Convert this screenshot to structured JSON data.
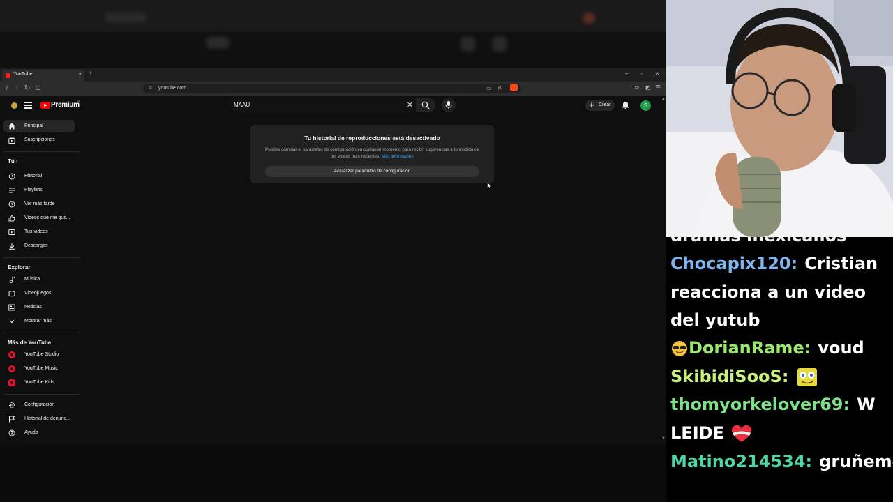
{
  "browser": {
    "tab_title": "YouTube",
    "tab_close": "×",
    "new_tab": "+",
    "url": "youtube.com",
    "win_min": "–",
    "win_max": "▫",
    "win_close": "×"
  },
  "youtube": {
    "logo_text": "Premium",
    "region": "PE",
    "search_query": "MAAU",
    "create_label": "Crear",
    "user_initial": "S",
    "sidebar": {
      "main": [
        {
          "label": "Principal",
          "icon": "home-icon"
        },
        {
          "label": "Suscripciones",
          "icon": "subscriptions-icon"
        }
      ],
      "you_header": "Tú",
      "you_items": [
        {
          "label": "Historial",
          "icon": "history-icon"
        },
        {
          "label": "Playlists",
          "icon": "playlists-icon"
        },
        {
          "label": "Ver más tarde",
          "icon": "watch-later-icon"
        },
        {
          "label": "Videos que me gus...",
          "icon": "like-icon"
        },
        {
          "label": "Tus videos",
          "icon": "your-videos-icon"
        },
        {
          "label": "Descargas",
          "icon": "download-icon"
        }
      ],
      "explore_header": "Explorar",
      "explore_items": [
        {
          "label": "Música",
          "icon": "music-icon"
        },
        {
          "label": "Videojuegos",
          "icon": "gaming-icon"
        },
        {
          "label": "Noticias",
          "icon": "news-icon"
        },
        {
          "label": "Mostrar más",
          "icon": "chevron-down-icon"
        }
      ],
      "more_header": "Más de YouTube",
      "more_items": [
        {
          "label": "YouTube Studio"
        },
        {
          "label": "YouTube Music"
        },
        {
          "label": "YouTube Kids"
        }
      ],
      "settings_items": [
        {
          "label": "Configuración",
          "icon": "gear-icon"
        },
        {
          "label": "Historial de denunc...",
          "icon": "flag-icon"
        },
        {
          "label": "Ayuda",
          "icon": "help-icon"
        }
      ]
    },
    "history_card": {
      "title": "Tu historial de reproducciones está desactivado",
      "body": "Puedes cambiar el parámetro de configuración en cualquier momento para recibir sugerencias a tu medida de los videos más recientes.",
      "link": "Más información",
      "button": "Actualizar parámetro de configuración"
    }
  },
  "chat": {
    "partial_top": "dramas mexicanos",
    "messages": [
      {
        "user": "Chocapix120:",
        "color": "#7fb6f0",
        "text": "Cristian reacciona a un video del yutub"
      },
      {
        "user": "DorianRame:",
        "color": "#9be86e",
        "text": "voud"
      },
      {
        "user": "SkibidiSooS:",
        "color": "#c8f07a",
        "text": ""
      },
      {
        "user": "thomyorkelover69:",
        "color": "#7fe08a",
        "text": "W LEIDE"
      },
      {
        "user": "Matino214534:",
        "color": "#4fd6a8",
        "text": "gruñeme"
      }
    ]
  }
}
